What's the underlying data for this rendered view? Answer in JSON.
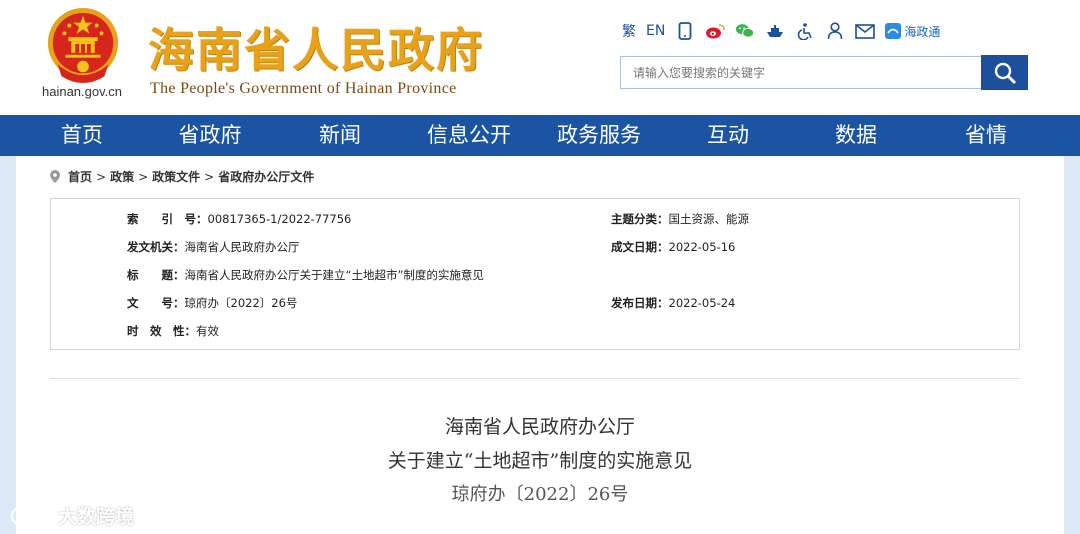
{
  "header": {
    "domain": "hainan.gov.cn",
    "title": "海南省人民政府",
    "subtitle": "The People's Government  of Hainan Province"
  },
  "toolbar": {
    "traditional": "繁",
    "english": "EN",
    "haizhengtong": "海政通",
    "icons": [
      "mobile-icon",
      "weibo-icon",
      "wechat-icon",
      "boat-icon",
      "accessibility-icon",
      "user-icon",
      "mail-icon"
    ]
  },
  "search": {
    "placeholder": "请输入您要搜索的关键字"
  },
  "nav": [
    "首页",
    "省政府",
    "新闻",
    "信息公开",
    "政务服务",
    "互动",
    "数据",
    "省情"
  ],
  "breadcrumb": [
    "首页",
    "政策",
    "政策文件",
    "省政府办公厅文件"
  ],
  "meta": {
    "index_label": "索　　引　号：",
    "index_value": "00817365-1/2022-77756",
    "topic_label": "主题分类：",
    "topic_value": "国土资源、能源",
    "issuer_label": "发文机关：",
    "issuer_value": "海南省人民政府办公厅",
    "date_label": "成文日期：",
    "date_value": "2022-05-16",
    "title_label": "标　　题：",
    "title_value": "海南省人民政府办公厅关于建立“土地超市”制度的实施意见",
    "docno_label": "文　　号：",
    "docno_value": "琼府办〔2022〕26号",
    "pub_label": "发布日期：",
    "pub_value": "2022-05-24",
    "valid_label": "时　效　性：",
    "valid_value": "有效"
  },
  "document": {
    "issuer": "海南省人民政府办公厅",
    "title": "关于建立“土地超市”制度的实施意见",
    "number": "琼府办〔2022〕26号"
  },
  "watermark": "大数跨境",
  "colors": {
    "nav_bg": "#1a54a2",
    "title_gold": "#e8a21a",
    "page_bg": "#dde9f6"
  }
}
